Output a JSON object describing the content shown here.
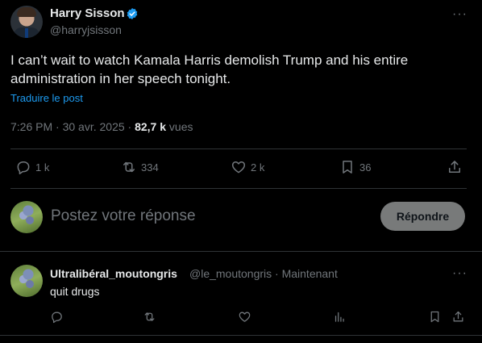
{
  "tweet": {
    "author_name": "Harry Sisson",
    "author_handle": "@harryjsisson",
    "text": "I can’t wait to watch Kamala Harris demolish Trump and his entire administration in her speech tonight.",
    "translate_label": "Traduire le post",
    "time": "7:26 PM · 30 avr. 2025 · ",
    "views_count": "82,7 k",
    "views_label": " vues",
    "more_label": "···",
    "verified_color": "#1d9bf0"
  },
  "actions": {
    "replies": "1 k",
    "reposts": "334",
    "likes": "2 k",
    "bookmarks": "36"
  },
  "composer": {
    "placeholder": "Postez votre réponse",
    "reply_button": "Répondre"
  },
  "reply": {
    "author_name": "Ultralibéral_moutongris",
    "author_handle": "@le_moutongris · Maintenant",
    "text": "quit drugs",
    "more_label": "···"
  },
  "icons": [
    "verified-badge-icon",
    "more-icon",
    "reply-icon",
    "repost-icon",
    "like-icon",
    "bookmark-icon",
    "share-icon",
    "views-icon"
  ]
}
